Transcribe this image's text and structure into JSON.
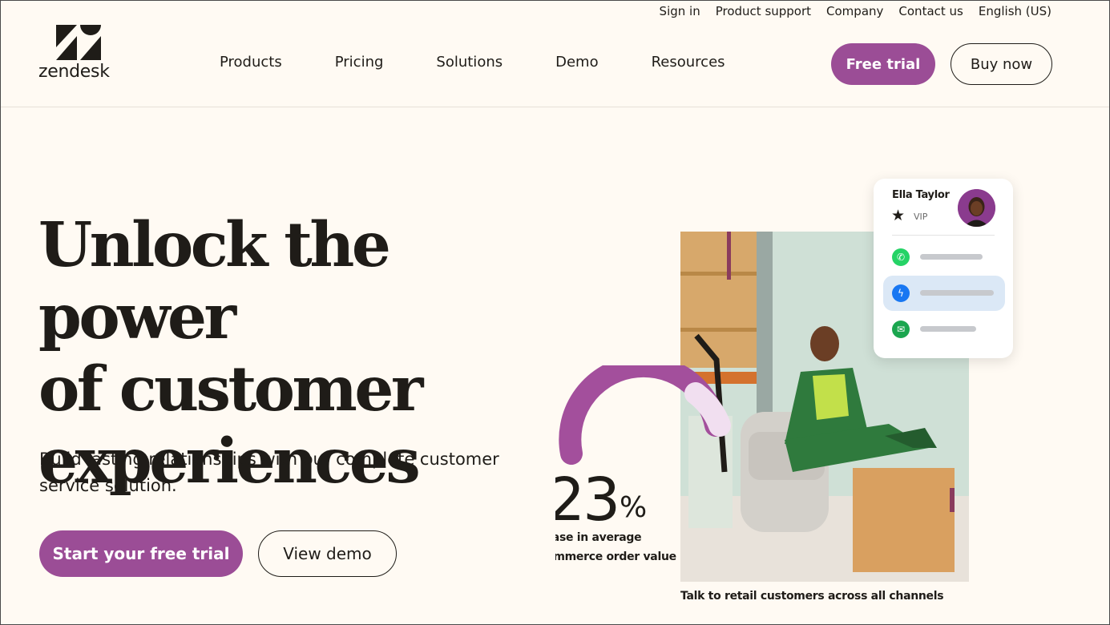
{
  "utility_nav": [
    "Sign in",
    "Product support",
    "Company",
    "Contact us",
    "English (US)"
  ],
  "brand": {
    "name": "zendesk",
    "accent": "#9b4d96"
  },
  "main_nav": [
    "Products",
    "Pricing",
    "Solutions",
    "Demo",
    "Resources"
  ],
  "header_buttons": {
    "free_trial": "Free trial",
    "buy_now": "Buy now"
  },
  "hero": {
    "title_lines": [
      "Unlock the power",
      "of customer",
      "experiences"
    ],
    "subtitle_line1": "Build lasting relationships with our complete customer",
    "subtitle_line2": "service solution.",
    "cta_primary": "Start your free trial",
    "cta_secondary": "View demo"
  },
  "media": {
    "stat_number": "23",
    "stat_unit": "%",
    "stat_line1": "rease in average",
    "stat_line2": "commerce order value",
    "caption": "Talk to retail customers across all channels",
    "card": {
      "name": "Ella Taylor",
      "tier": "VIP",
      "channels": [
        {
          "icon": "whatsapp-icon",
          "color": "#25d366"
        },
        {
          "icon": "messenger-icon",
          "color": "#1877f2"
        },
        {
          "icon": "email-icon",
          "color": "#1ba64f"
        }
      ]
    }
  }
}
